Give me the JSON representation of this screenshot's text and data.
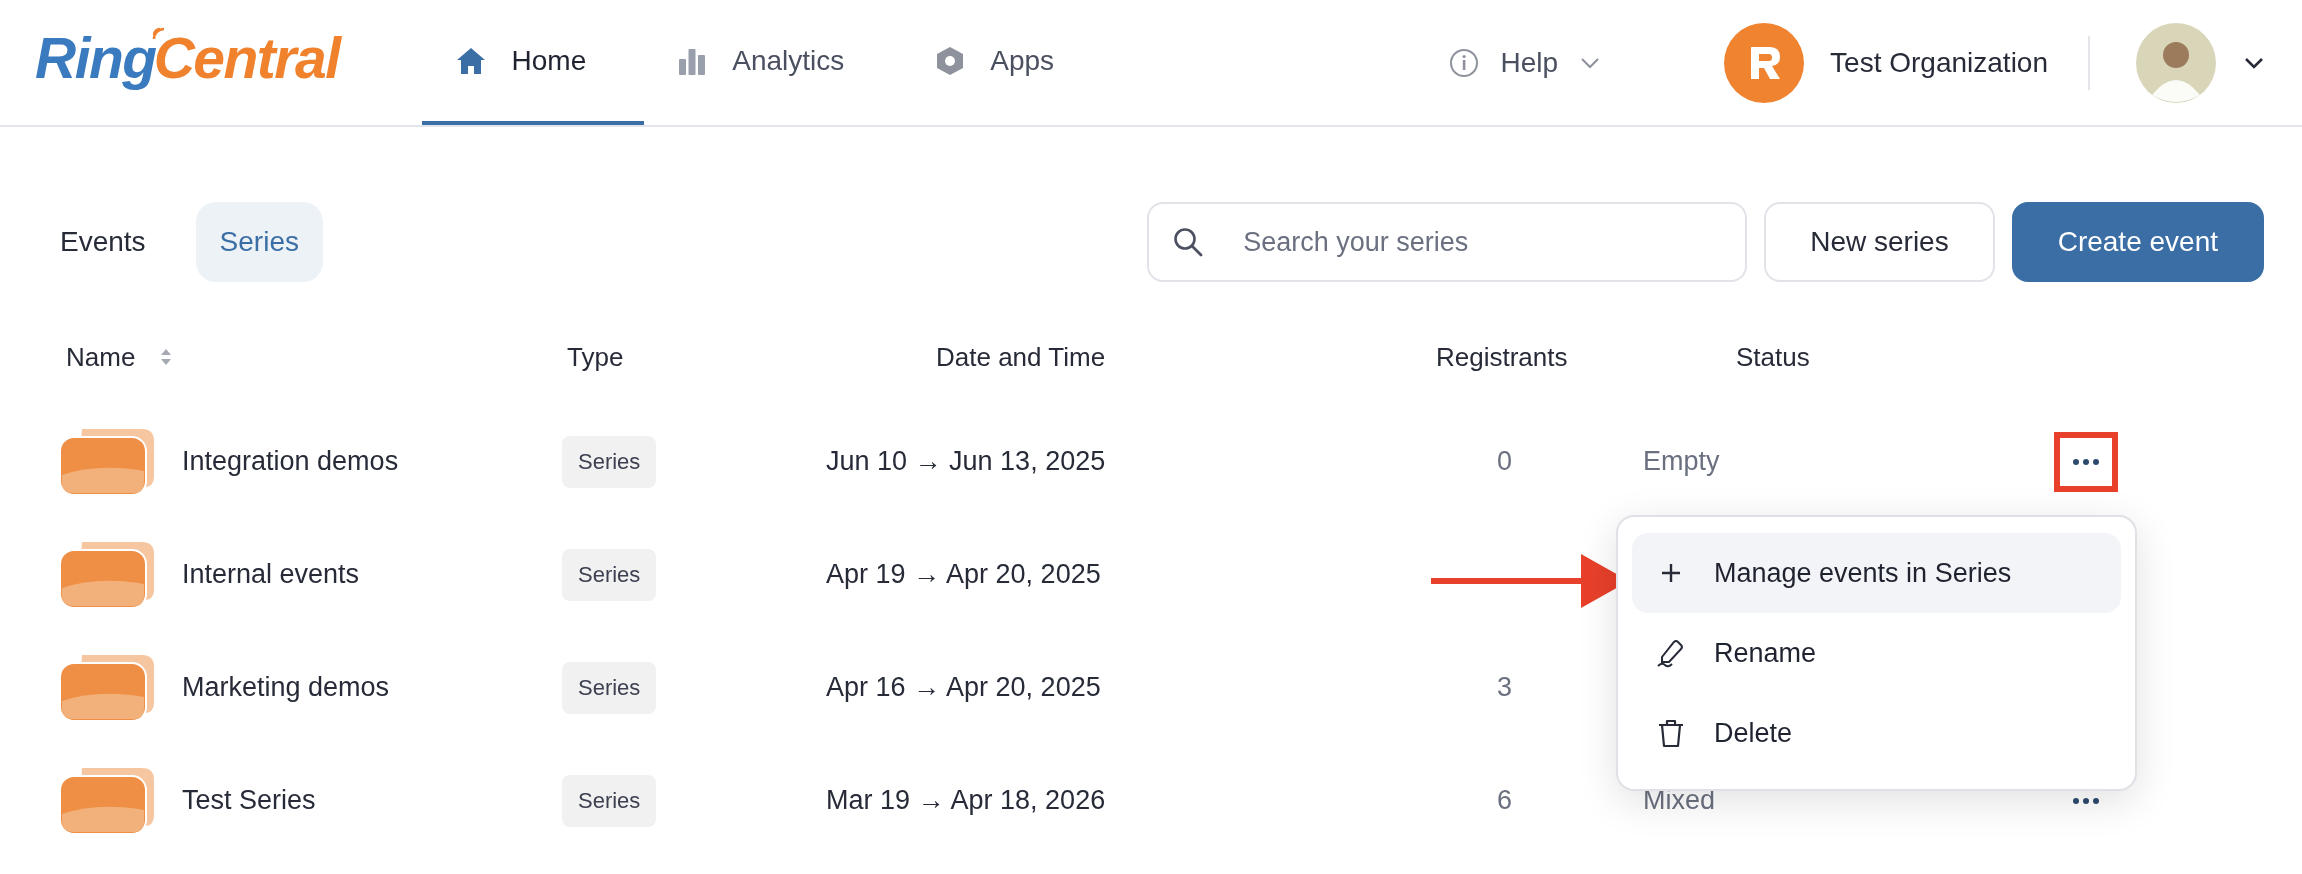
{
  "header": {
    "logo": [
      "Ring",
      "Central"
    ],
    "nav": [
      {
        "label": "Home",
        "selected": true
      },
      {
        "label": "Analytics",
        "selected": false
      },
      {
        "label": "Apps",
        "selected": false
      }
    ],
    "help": {
      "label": "Help"
    },
    "organization": {
      "name": "Test Organization"
    }
  },
  "tabs": [
    {
      "label": "Events",
      "selected": false
    },
    {
      "label": "Series",
      "selected": true
    }
  ],
  "search": {
    "placeholder": "Search your series"
  },
  "buttons": [
    {
      "label": "New series",
      "kind": "secondary"
    },
    {
      "label": "Create event",
      "kind": "primary"
    }
  ],
  "table": {
    "columns": [
      {
        "label": "Name",
        "sortable": true
      },
      {
        "label": "Type",
        "sortable": false
      },
      {
        "label": "Date and Time",
        "sortable": false
      },
      {
        "label": "Registrants",
        "sortable": false
      },
      {
        "label": "Status",
        "sortable": false
      }
    ],
    "rows": [
      {
        "name": "Integration demos",
        "type": "Series",
        "dates": "Jun 10 → Jun 13, 2025",
        "registrants": "0",
        "status": "Empty",
        "menu_button": true,
        "highlighted": true
      },
      {
        "name": "Internal events",
        "type": "Series",
        "dates": "Apr 19 → Apr 20, 2025",
        "menu_button": false
      },
      {
        "name": "Marketing demos",
        "type": "Series",
        "dates": "Apr 16 → Apr 20, 2025",
        "registrants": "3",
        "menu_button": false
      },
      {
        "name": "Test Series",
        "type": "Series",
        "dates": "Mar 19 → Apr 18, 2026",
        "registrants": "6",
        "status": "Mixed",
        "menu_button": true,
        "highlighted": false
      }
    ]
  },
  "menu": {
    "items": [
      {
        "label": "Manage events in Series",
        "selected": true
      },
      {
        "label": "Rename",
        "selected": false
      },
      {
        "label": "Delete",
        "selected": false
      }
    ]
  },
  "annotation": {
    "arrow": true
  }
}
